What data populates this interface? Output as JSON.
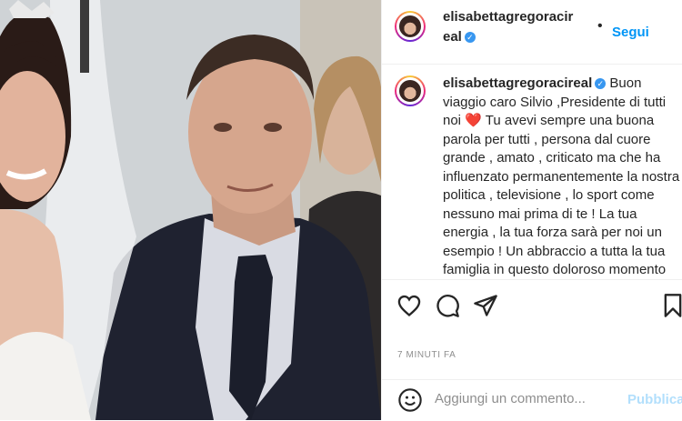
{
  "post": {
    "username": "elisabettagregoracireal",
    "verified_icon": "verified-badge-icon",
    "follow_label": "Segui",
    "separator": "•",
    "caption_username": "elisabettagregoracireal",
    "caption_part1": "Buon viaggio caro Silvio ,Presidente di tutti noi",
    "caption_emoji": "❤️",
    "caption_part2": "Tu avevi sempre una buona parola per tutti , persona dal cuore grande , amato , criticato ma che ha influenzato permanentemente la nostra politica , televisione , lo sport come nessuno mai prima di te ! La tua energia , la tua forza sarà per noi un esempio ! Un abbraccio a tutta la tua famiglia in questo doloroso momento",
    "time_label": "7 MINUTI FA"
  },
  "actions": {
    "icons": [
      "heart-icon",
      "comment-icon",
      "share-icon",
      "bookmark-icon"
    ]
  },
  "comment": {
    "placeholder": "Aggiungi un commento...",
    "value": "",
    "publish_label": "Pubblica"
  },
  "colors": {
    "accent": "#0095f6",
    "publish_disabled": "#b2dffc",
    "heart": "#e0245e",
    "verified": "#3897f0"
  }
}
